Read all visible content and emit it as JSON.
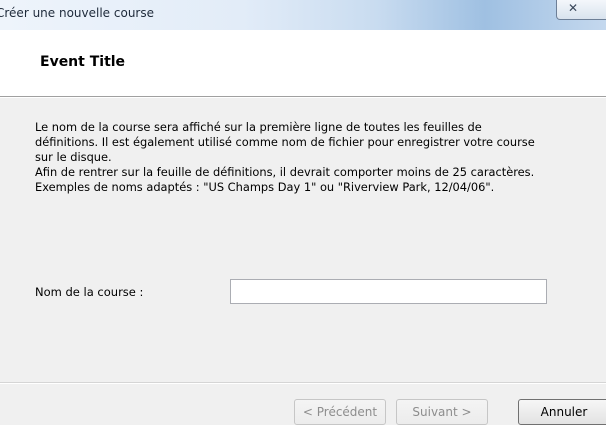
{
  "window": {
    "title": "Créer une nouvelle course",
    "close_icon": "close-icon"
  },
  "header": {
    "title": "Event Title"
  },
  "content": {
    "description_lines": [
      "Le nom de la course sera affiché sur la première ligne de toutes les feuilles de",
      "définitions. Il est également utilisé comme nom de fichier pour enregistrer votre course",
      "sur le disque.",
      "Afin de rentrer sur la feuille de définitions, il devrait comporter moins de 25 caractères.",
      "Exemples de noms adaptés : \"US Champs Day 1\" ou \"Riverview Park, 12/04/06\"."
    ],
    "name_label": "Nom de la course :",
    "name_value": "",
    "name_placeholder": ""
  },
  "footer": {
    "prev_label": "< Précédent",
    "next_label": "Suivant >",
    "cancel_label": "Annuler",
    "prev_disabled": true,
    "next_disabled": true
  },
  "colors": {
    "content_background": "#f0f0f0",
    "header_background": "#ffffff",
    "titlebar_accent": "#9fc0e2"
  }
}
